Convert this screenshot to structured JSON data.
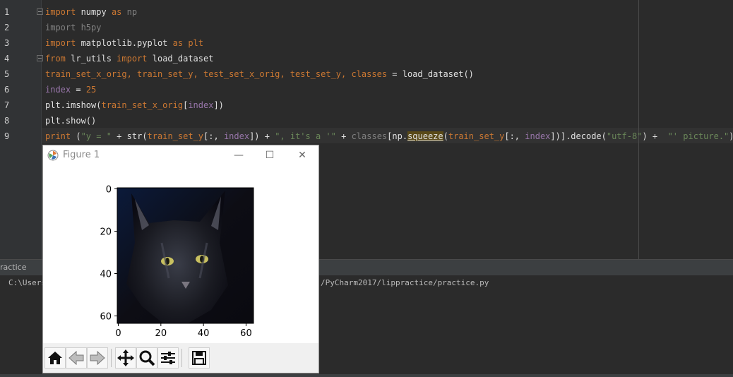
{
  "editor": {
    "line_numbers": [
      "1",
      "2",
      "3",
      "4",
      "5",
      "6",
      "7",
      "8",
      "9"
    ],
    "lines": [
      [
        {
          "t": "import",
          "c": "kw"
        },
        {
          "t": " numpy ",
          "c": "wht"
        },
        {
          "t": "as",
          "c": "kw"
        },
        {
          "t": " np",
          "c": "gray"
        }
      ],
      [
        {
          "t": "import h5py",
          "c": "gray"
        }
      ],
      [
        {
          "t": "import",
          "c": "kw"
        },
        {
          "t": " matplotlib.pyplot ",
          "c": "wht"
        },
        {
          "t": "as",
          "c": "kw"
        },
        {
          "t": " plt",
          "c": "kw"
        }
      ],
      [
        {
          "t": "from",
          "c": "kw"
        },
        {
          "t": " lr_utils ",
          "c": "wht"
        },
        {
          "t": "import",
          "c": "kw"
        },
        {
          "t": " load_dataset",
          "c": "wht"
        }
      ],
      [
        {
          "t": "train_set_x_orig, train_set_y, test_set_x_orig, test_set_y, classes",
          "c": "kw"
        },
        {
          "t": " = ",
          "c": "wht"
        },
        {
          "t": "load_dataset()",
          "c": "wht"
        }
      ],
      [
        {
          "t": "index",
          "c": "teal"
        },
        {
          "t": " = ",
          "c": "wht"
        },
        {
          "t": "25",
          "c": "kw"
        }
      ],
      [
        {
          "t": "plt.imshow(",
          "c": "wht"
        },
        {
          "t": "train_set_x_orig",
          "c": "kw"
        },
        {
          "t": "[",
          "c": "wht"
        },
        {
          "t": "index",
          "c": "teal"
        },
        {
          "t": "])",
          "c": "wht"
        }
      ],
      [
        {
          "t": "plt.show()",
          "c": "wht"
        }
      ],
      [
        {
          "t": "print",
          "c": "kw"
        },
        {
          "t": " (",
          "c": "wht"
        },
        {
          "t": "\"y = \"",
          "c": "str"
        },
        {
          "t": " + ",
          "c": "wht"
        },
        {
          "t": "str",
          "c": "wht"
        },
        {
          "t": "(",
          "c": "wht"
        },
        {
          "t": "train_set_y",
          "c": "kw"
        },
        {
          "t": "[:, ",
          "c": "wht"
        },
        {
          "t": "index",
          "c": "teal"
        },
        {
          "t": "]) + ",
          "c": "wht"
        },
        {
          "t": "\", it's a '\"",
          "c": "str"
        },
        {
          "t": " + ",
          "c": "wht"
        },
        {
          "t": "classes",
          "c": "gray"
        },
        {
          "t": "[np.",
          "c": "wht"
        },
        {
          "t": "squeeze",
          "c": "sq"
        },
        {
          "t": "(",
          "c": "wht"
        },
        {
          "t": "train_set_y",
          "c": "kw"
        },
        {
          "t": "[:, ",
          "c": "wht"
        },
        {
          "t": "index",
          "c": "teal"
        },
        {
          "t": "])].decode(",
          "c": "wht"
        },
        {
          "t": "\"utf-8\"",
          "c": "str"
        },
        {
          "t": ") + ",
          "c": "wht"
        },
        {
          "t": " \"' picture.\"",
          "c": "str"
        },
        {
          "t": ")",
          "c": "wht"
        }
      ]
    ]
  },
  "run_panel": {
    "tab_label": "ractice",
    "console_left": "C:\\Users",
    "console_right": "/PyCharm2017/lippractice/practice.py"
  },
  "figure": {
    "title": "Figure 1",
    "minimize": "—",
    "maximize": "☐",
    "close": "✕",
    "y_ticks": [
      "0",
      "20",
      "40",
      "60"
    ],
    "x_ticks": [
      "0",
      "20",
      "40",
      "60"
    ],
    "toolbar": [
      "home-icon",
      "back-icon",
      "forward-icon",
      "move-icon",
      "zoom-icon",
      "configure-icon",
      "save-icon"
    ]
  }
}
